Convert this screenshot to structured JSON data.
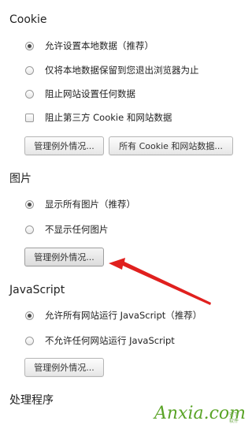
{
  "cookie": {
    "heading": "Cookie",
    "options": [
      {
        "label": "允许设置本地数据（推荐）",
        "checked": true
      },
      {
        "label": "仅将本地数据保留到您退出浏览器为止",
        "checked": false
      },
      {
        "label": "阻止网站设置任何数据",
        "checked": false
      }
    ],
    "block_third_party_label": "阻止第三方 Cookie 和网站数据",
    "block_third_party_checked": false,
    "manage_exceptions_button": "管理例外情况...",
    "all_cookies_button": "所有 Cookie 和网站数据..."
  },
  "images": {
    "heading": "图片",
    "options": [
      {
        "label": "显示所有图片（推荐）",
        "checked": true
      },
      {
        "label": "不显示任何图片",
        "checked": false
      }
    ],
    "manage_exceptions_button": "管理例外情况..."
  },
  "javascript": {
    "heading": "JavaScript",
    "options": [
      {
        "label": "允许所有网站运行 JavaScript（推荐）",
        "checked": true
      },
      {
        "label": "不允许任何网站运行 JavaScript",
        "checked": false
      }
    ],
    "manage_exceptions_button": "管理例外情况..."
  },
  "handlers": {
    "heading": "处理程序"
  },
  "annotation": {
    "arrow_color": "#e0201e"
  },
  "watermark": {
    "text": "Anxia.com",
    "color": "#5aa427"
  }
}
